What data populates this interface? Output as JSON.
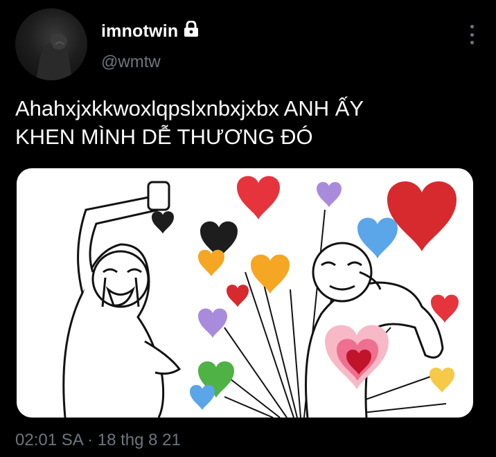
{
  "user": {
    "display_name": "imnotwin",
    "handle": "@wmtw",
    "protected_icon": "lock-icon",
    "avatar_icon": "avatar"
  },
  "tweet": {
    "text_line1": "Ahahxjxkkwoxlqpslxnbxjxbx ANH ẤY",
    "text_line2": "KHEN MÌNH DỄ THƯƠNG ĐÓ",
    "time": "02:01 SA",
    "separator": " · ",
    "date": "18 thg 8 21"
  },
  "media": {
    "description_icon": "crying-happy-meme-illustration",
    "heart_colors": [
      "#e6343d",
      "#d62a2e",
      "#f5a623",
      "#1d1d1d",
      "#a98bdc",
      "#4fb244",
      "#5aa6e8",
      "#ee6f8f"
    ]
  },
  "menu": {
    "icon": "more-vertical-icon"
  },
  "colors": {
    "background": "#000000",
    "secondary_text": "#6e767d",
    "primary_text": "#ffffff"
  }
}
